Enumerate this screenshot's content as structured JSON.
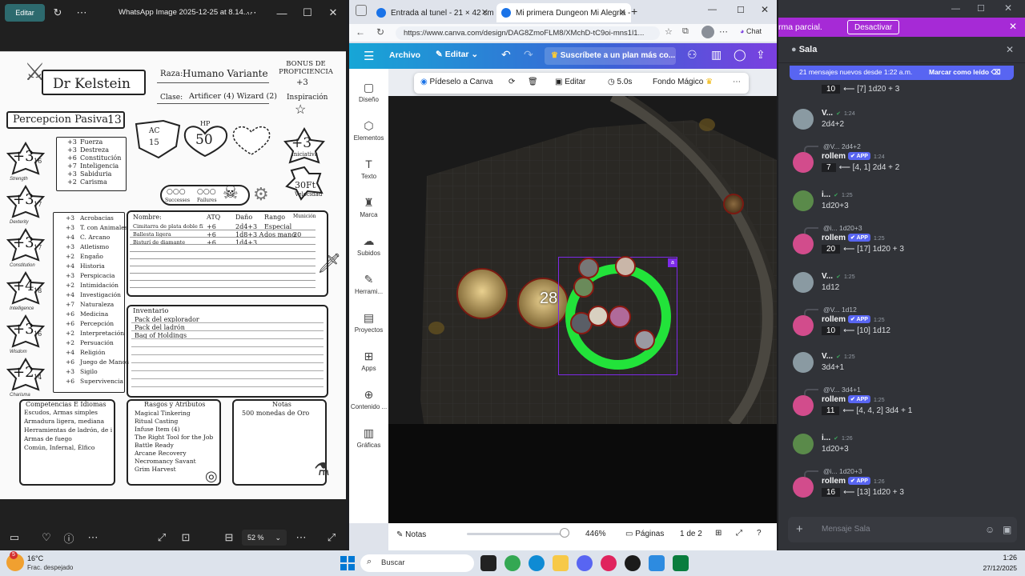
{
  "photos": {
    "app_label": "Editar",
    "title": "WhatsApp Image 2025-12-25 at 8.14....",
    "zoom": "52 %",
    "sheet": {
      "name": "Dr Kelstein",
      "race_label": "Raza:",
      "race": "Humano Variante",
      "class_label": "Clase:",
      "class": "Artificer (4) Wizard (2)",
      "prof_bonus_label": "BONUS DE PROFICIENCIA",
      "prof_bonus": "+3",
      "inspiration": "Inspiración",
      "passive_label": "Percepcion Pasiva",
      "passive_value": "13",
      "ac_label": "AC",
      "ac": "15",
      "hp_label": "HP",
      "hp": "50",
      "initiative": "+3",
      "initiative_label": "Iniciativa",
      "speed": "30Ft",
      "speed_label": "Velocidad",
      "successes": "Successes",
      "failures": "Failures",
      "stats": [
        {
          "mod": "+3",
          "score": "16",
          "name": "Strength"
        },
        {
          "mod": "+3",
          "score": "17",
          "name": "Dexterity"
        },
        {
          "mod": "+3",
          "score": "17",
          "name": "Constitution"
        },
        {
          "mod": "+4",
          "score": "18",
          "name": "Intelligence"
        },
        {
          "mod": "+3",
          "score": "16",
          "name": "Wisdom"
        },
        {
          "mod": "+2",
          "score": "14",
          "name": "Charisma"
        }
      ],
      "saves": [
        {
          "v": "+3",
          "n": "Fuerza"
        },
        {
          "v": "+3",
          "n": "Destreza"
        },
        {
          "v": "+6",
          "n": "Constitución"
        },
        {
          "v": "+7",
          "n": "Inteligencia"
        },
        {
          "v": "+3",
          "n": "Sabiduria"
        },
        {
          "v": "+2",
          "n": "Carisma"
        }
      ],
      "skills": [
        {
          "v": "+3",
          "n": "Acrobacias"
        },
        {
          "v": "+3",
          "n": "T. con Animales"
        },
        {
          "v": "+4",
          "n": "C. Arcano"
        },
        {
          "v": "+3",
          "n": "Atletismo"
        },
        {
          "v": "+2",
          "n": "Engaño"
        },
        {
          "v": "+4",
          "n": "Historia"
        },
        {
          "v": "+3",
          "n": "Perspicacia"
        },
        {
          "v": "+2",
          "n": "Intimidación"
        },
        {
          "v": "+4",
          "n": "Investigación"
        },
        {
          "v": "+7",
          "n": "Naturaleza"
        },
        {
          "v": "+6",
          "n": "Medicina"
        },
        {
          "v": "+6",
          "n": "Percepción"
        },
        {
          "v": "+2",
          "n": "Interpretación"
        },
        {
          "v": "+2",
          "n": "Persuación"
        },
        {
          "v": "+4",
          "n": "Religión"
        },
        {
          "v": "+6",
          "n": "Juego de Manos"
        },
        {
          "v": "+3",
          "n": "Sigilo"
        },
        {
          "v": "+6",
          "n": "Supervivencia"
        }
      ],
      "attack_headers": [
        "Nombre:",
        "ATQ",
        "Daño",
        "Rango",
        "Munición"
      ],
      "attacks": [
        [
          "Cimitarra de plata doble filo",
          "+6",
          "2d4+3",
          "Especial",
          ""
        ],
        [
          "Ballesta ligera",
          "+6",
          "1d8+3 A",
          "dos manos",
          "20"
        ],
        [
          "Bisturí de diamante",
          "+6",
          "1d4+3",
          "",
          ""
        ]
      ],
      "inventory_title": "Inventario",
      "inventory": [
        "Pack del explorador",
        "Pack del ladrón",
        "Bag of Holdings"
      ],
      "comp_title": "Competencias E Idiomas",
      "comp": [
        "Escudos, Armas simples",
        "Armadura ligera, mediana",
        "Herramientas de ladrón, de ingeniero",
        "Armas de fuego",
        "Común, Infernal, Élfico"
      ],
      "traits_title": "Rasgos y Atributos",
      "traits": [
        "Magical Tinkering",
        "Ritual Casting",
        "Infuse Item (4)",
        "The Right Tool for the Job",
        "Battle Ready",
        "Arcane Recovery",
        "Necromancy Savant",
        "Grim Harvest"
      ],
      "notes_title": "Notas",
      "notes": [
        "500 monedas de Oro"
      ]
    }
  },
  "browser": {
    "tabs": [
      {
        "label": "Entrada al tunel - 21 × 42 cm"
      },
      {
        "label": "Mi primera Dungeon Mi Alegria -"
      }
    ],
    "url": "https://www.canva.com/design/DAG8ZmoFLM8/XMchD-tC9oi-mns1l1...",
    "chat_label": "Chat",
    "canva": {
      "archivo": "Archivo",
      "editar": "Editar",
      "subscribe": "Suscríbete a un plan más co...",
      "side": [
        "Diseño",
        "Elementos",
        "Texto",
        "Marca",
        "Subidos",
        "Herrami...",
        "Proyectos",
        "Apps",
        "Contenido ...",
        "Gráficas"
      ],
      "ctx": {
        "ask": "Pídeselo a Canva",
        "edit": "Editar",
        "duration": "5.0s",
        "bg": "Fondo Mágico"
      },
      "token_number": "28",
      "bottom": {
        "notes": "Notas",
        "zoom": "446%",
        "pages": "Páginas",
        "page_of": "1 de 2"
      }
    }
  },
  "discord": {
    "banner_text": "rma parcial.",
    "banner_btn": "Desactivar",
    "channel": "Sala",
    "new_msgs": "21 mensajes nuevos desde 1:22 a.m.",
    "mark_read": "Marcar como leído",
    "input_placeholder": "Mensaje Sala",
    "messages": [
      {
        "kind": "cont",
        "num": "10",
        "text": "⟵ [7] 1d20 + 3"
      },
      {
        "kind": "user",
        "name": "V...",
        "ts": "1:24",
        "text": "2d4+2"
      },
      {
        "kind": "bot",
        "reply": "@V...  2d4+2",
        "name": "rollem",
        "ts": "1:24",
        "num": "7",
        "text": "⟵ [4, 1] 2d4 + 2"
      },
      {
        "kind": "user",
        "name": "i...",
        "ts": "1:25",
        "text": "1d20+3"
      },
      {
        "kind": "bot",
        "reply": "@i...  1d20+3",
        "name": "rollem",
        "ts": "1:25",
        "num": "20",
        "text": "⟵ [17] 1d20 + 3"
      },
      {
        "kind": "user",
        "name": "V...",
        "ts": "1:25",
        "text": "1d12"
      },
      {
        "kind": "bot",
        "reply": "@V...  1d12",
        "name": "rollem",
        "ts": "1:25",
        "num": "10",
        "text": "⟵ [10] 1d12"
      },
      {
        "kind": "user",
        "name": "V...",
        "ts": "1:25",
        "text": "3d4+1"
      },
      {
        "kind": "bot",
        "reply": "@V...  3d4+1",
        "name": "rollem",
        "ts": "1:25",
        "num": "11",
        "text": "⟵ [4, 4, 2] 3d4 + 1"
      },
      {
        "kind": "user",
        "name": "i...",
        "ts": "1:26",
        "text": "1d20+3"
      },
      {
        "kind": "bot",
        "reply": "@i...  1d20+3",
        "name": "rollem",
        "ts": "1:26",
        "num": "16",
        "text": "⟵ [13] 1d20 + 3"
      }
    ]
  },
  "taskbar": {
    "weather_temp": "16°C",
    "weather_desc": "Frac. despejado",
    "weather_badge": "5",
    "search": "Buscar",
    "time": "1:26",
    "date": "27/12/2025"
  },
  "colors": {
    "canva_gradient_start": "#17a6d6",
    "canva_gradient_end": "#7b3fe0",
    "selection_ring": "#22e33a",
    "discord_bg": "#313338",
    "app_badge": "#5865f2",
    "banner": "#a62ad6"
  }
}
